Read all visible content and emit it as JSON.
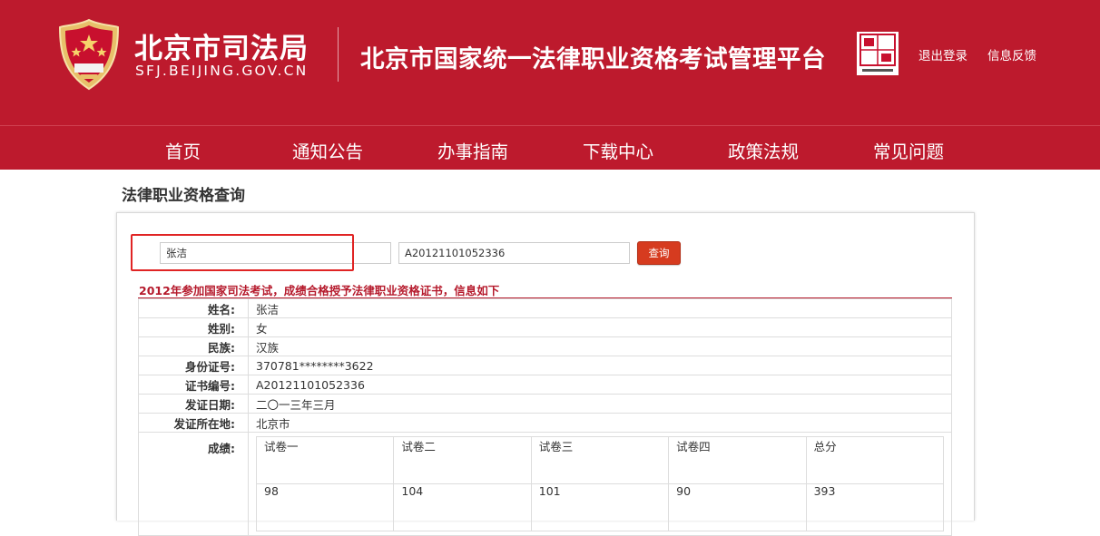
{
  "header": {
    "site_name": "北京市司法局",
    "site_domain": "SFJ.BEIJING.GOV.CN",
    "platform_title": "北京市国家统一法律职业资格考试管理平台",
    "logout": "退出登录",
    "feedback": "信息反馈",
    "colors": {
      "brand_red": "#bd1a2d",
      "accent": "#d63b1f"
    }
  },
  "nav": {
    "items": [
      {
        "label": "首页"
      },
      {
        "label": "通知公告"
      },
      {
        "label": "办事指南"
      },
      {
        "label": "下载中心"
      },
      {
        "label": "政策法规"
      },
      {
        "label": "常见问题"
      }
    ]
  },
  "page": {
    "title": "法律职业资格查询"
  },
  "search": {
    "name_value": "张洁",
    "cert_value": "A20121101052336",
    "query_label": "查询"
  },
  "result": {
    "heading": "2012年参加国家司法考试，成绩合格授予法律职业资格证书，信息如下",
    "rows": [
      {
        "label": "姓名:",
        "value": "张洁"
      },
      {
        "label": "姓别:",
        "value": "女"
      },
      {
        "label": "民族:",
        "value": "汉族"
      },
      {
        "label": "身份证号:",
        "value": "370781********3622"
      },
      {
        "label": "证书编号:",
        "value": "A20121101052336"
      },
      {
        "label": "发证日期:",
        "value": "二〇一三年三月"
      },
      {
        "label": "发证所在地:",
        "value": "北京市"
      }
    ],
    "scores_label": "成绩:",
    "score_headers": [
      "试卷一",
      "试卷二",
      "试卷三",
      "试卷四",
      "总分"
    ],
    "score_values": [
      "98",
      "104",
      "101",
      "90",
      "393"
    ]
  },
  "icons": {
    "emblem": "justice-emblem-icon",
    "beijing_logo": "beijing-capital-logo-icon"
  }
}
